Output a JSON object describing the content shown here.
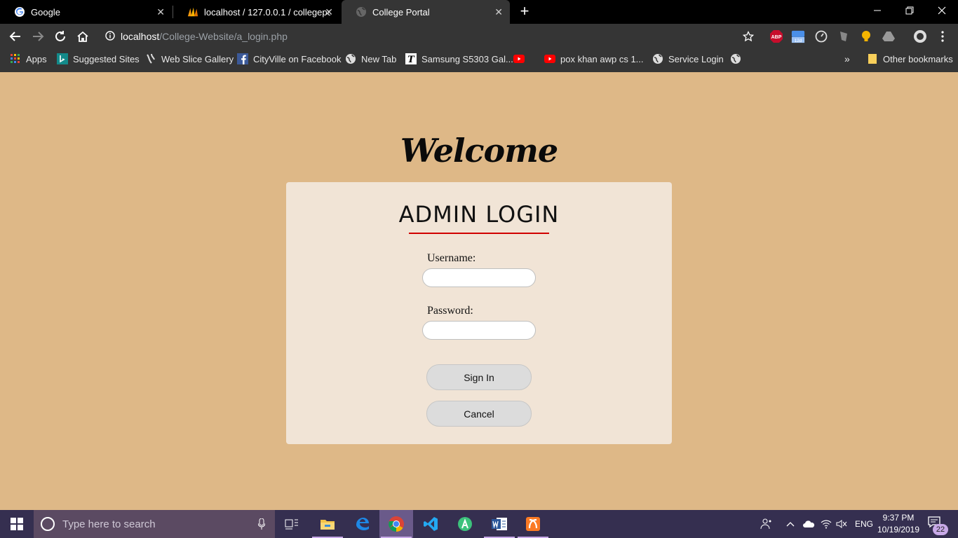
{
  "browser": {
    "tabs": [
      {
        "title": "Google",
        "icon": "google-icon"
      },
      {
        "title": "localhost / 127.0.0.1 / collegepor",
        "icon": "phpmyadmin-icon"
      },
      {
        "title": "College Portal",
        "icon": "globe-icon"
      }
    ],
    "url_host": "localhost",
    "url_path": "/College-Website/a_login.php",
    "bookmarks": [
      {
        "label": "Apps",
        "icon": "apps-grid-icon"
      },
      {
        "label": "Suggested Sites",
        "icon": "bing-icon"
      },
      {
        "label": "Web Slice Gallery",
        "icon": "webslice-icon"
      },
      {
        "label": "CityVille on Facebook",
        "icon": "facebook-icon"
      },
      {
        "label": "New Tab",
        "icon": "globe-icon"
      },
      {
        "label": "Samsung S5303 Gal...",
        "icon": "t-icon"
      },
      {
        "label": "",
        "icon": "youtube-icon"
      },
      {
        "label": "pox khan awp cs 1...",
        "icon": "youtube-icon"
      },
      {
        "label": "Service Login",
        "icon": "globe-icon"
      },
      {
        "label": "",
        "icon": "globe-icon"
      }
    ],
    "other_bookmarks": "Other bookmarks",
    "calendar_badge": "12d",
    "abp_label": "ABP"
  },
  "page": {
    "welcome": "Welcome",
    "login_title": "ADMIN LOGIN",
    "username_label": "Username:",
    "username_value": "",
    "password_label": "Password:",
    "password_value": "",
    "signin_label": "Sign In",
    "cancel_label": "Cancel",
    "background_color": "#deb887",
    "card_color": "#f1e4d6",
    "accent_color": "#d10000"
  },
  "taskbar": {
    "search_placeholder": "Type here to search",
    "language": "ENG",
    "time": "9:37 PM",
    "date": "10/19/2019",
    "notification_count": "22"
  }
}
